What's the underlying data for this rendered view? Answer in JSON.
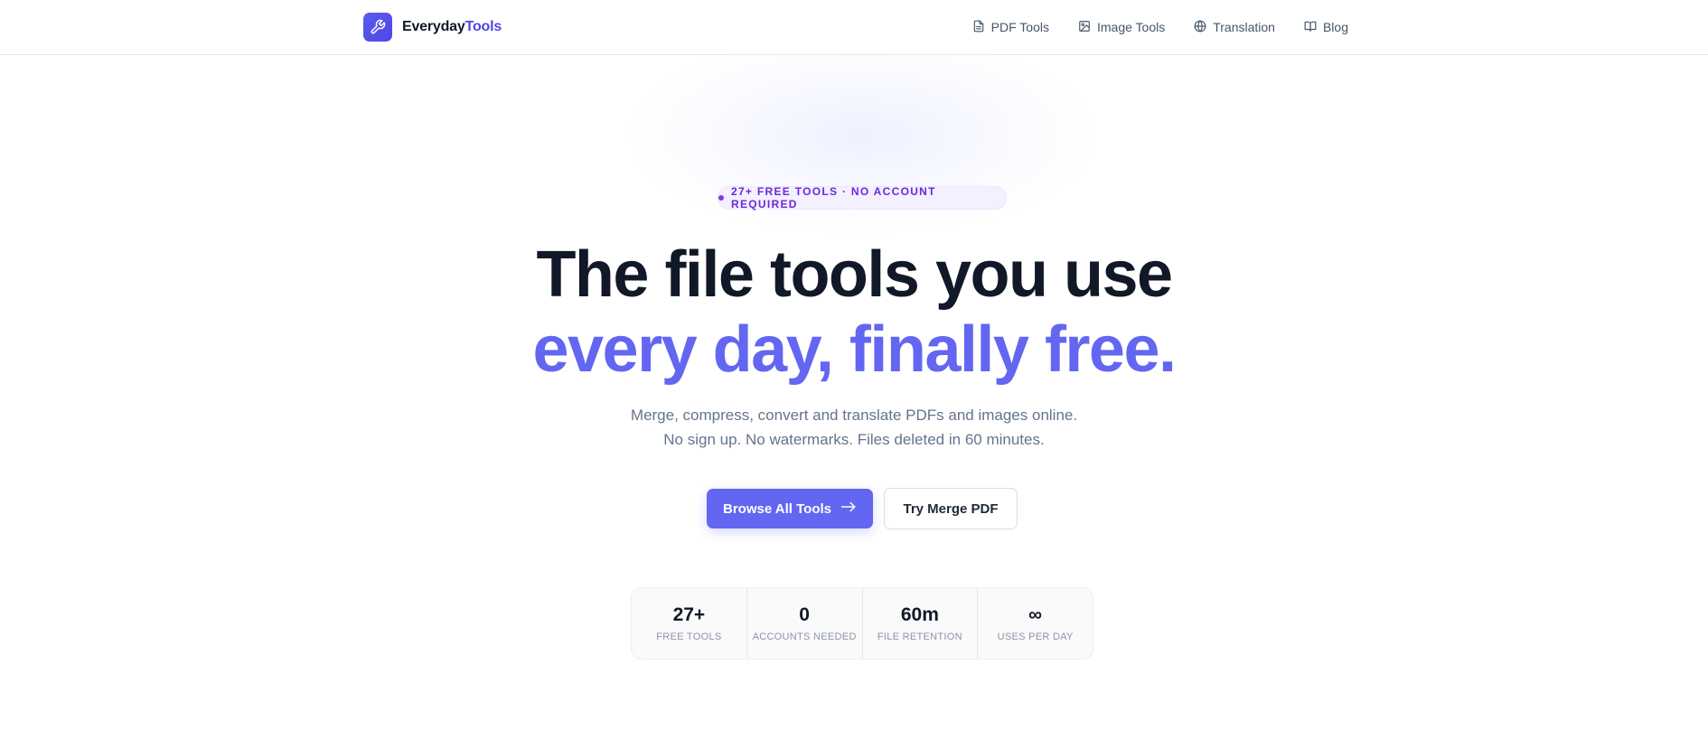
{
  "header": {
    "brand": {
      "logo_icon": "wrench-icon",
      "name_primary": "Everyday",
      "name_accent": "Tools"
    },
    "nav": [
      {
        "label": "PDF Tools",
        "icon": "document-icon"
      },
      {
        "label": "Image Tools",
        "icon": "image-icon"
      },
      {
        "label": "Translation",
        "icon": "globe-icon"
      },
      {
        "label": "Blog",
        "icon": "book-open-icon"
      }
    ]
  },
  "hero": {
    "badge": "27+ FREE TOOLS · NO ACCOUNT REQUIRED",
    "title_line1": "The file tools you use",
    "title_line2": "every day, finally free.",
    "subtitle_line1": "Merge, compress, convert and translate PDFs and images online.",
    "subtitle_line2": "No sign up. No watermarks. Files deleted in 60 minutes.",
    "primary_button": "Browse All Tools",
    "primary_button_icon": "arrow-right-icon",
    "secondary_button": "Try Merge PDF"
  },
  "stats": [
    {
      "value": "27+",
      "label": "FREE TOOLS"
    },
    {
      "value": "0",
      "label": "ACCOUNTS NEEDED"
    },
    {
      "value": "60m",
      "label": "FILE RETENTION"
    },
    {
      "value": "∞",
      "label": "USES PER DAY"
    }
  ],
  "colors": {
    "accent": "#6366f1",
    "brand": "#4f46e5",
    "badge_text": "#6d28d9",
    "heading": "#111827",
    "muted": "#64748b"
  }
}
